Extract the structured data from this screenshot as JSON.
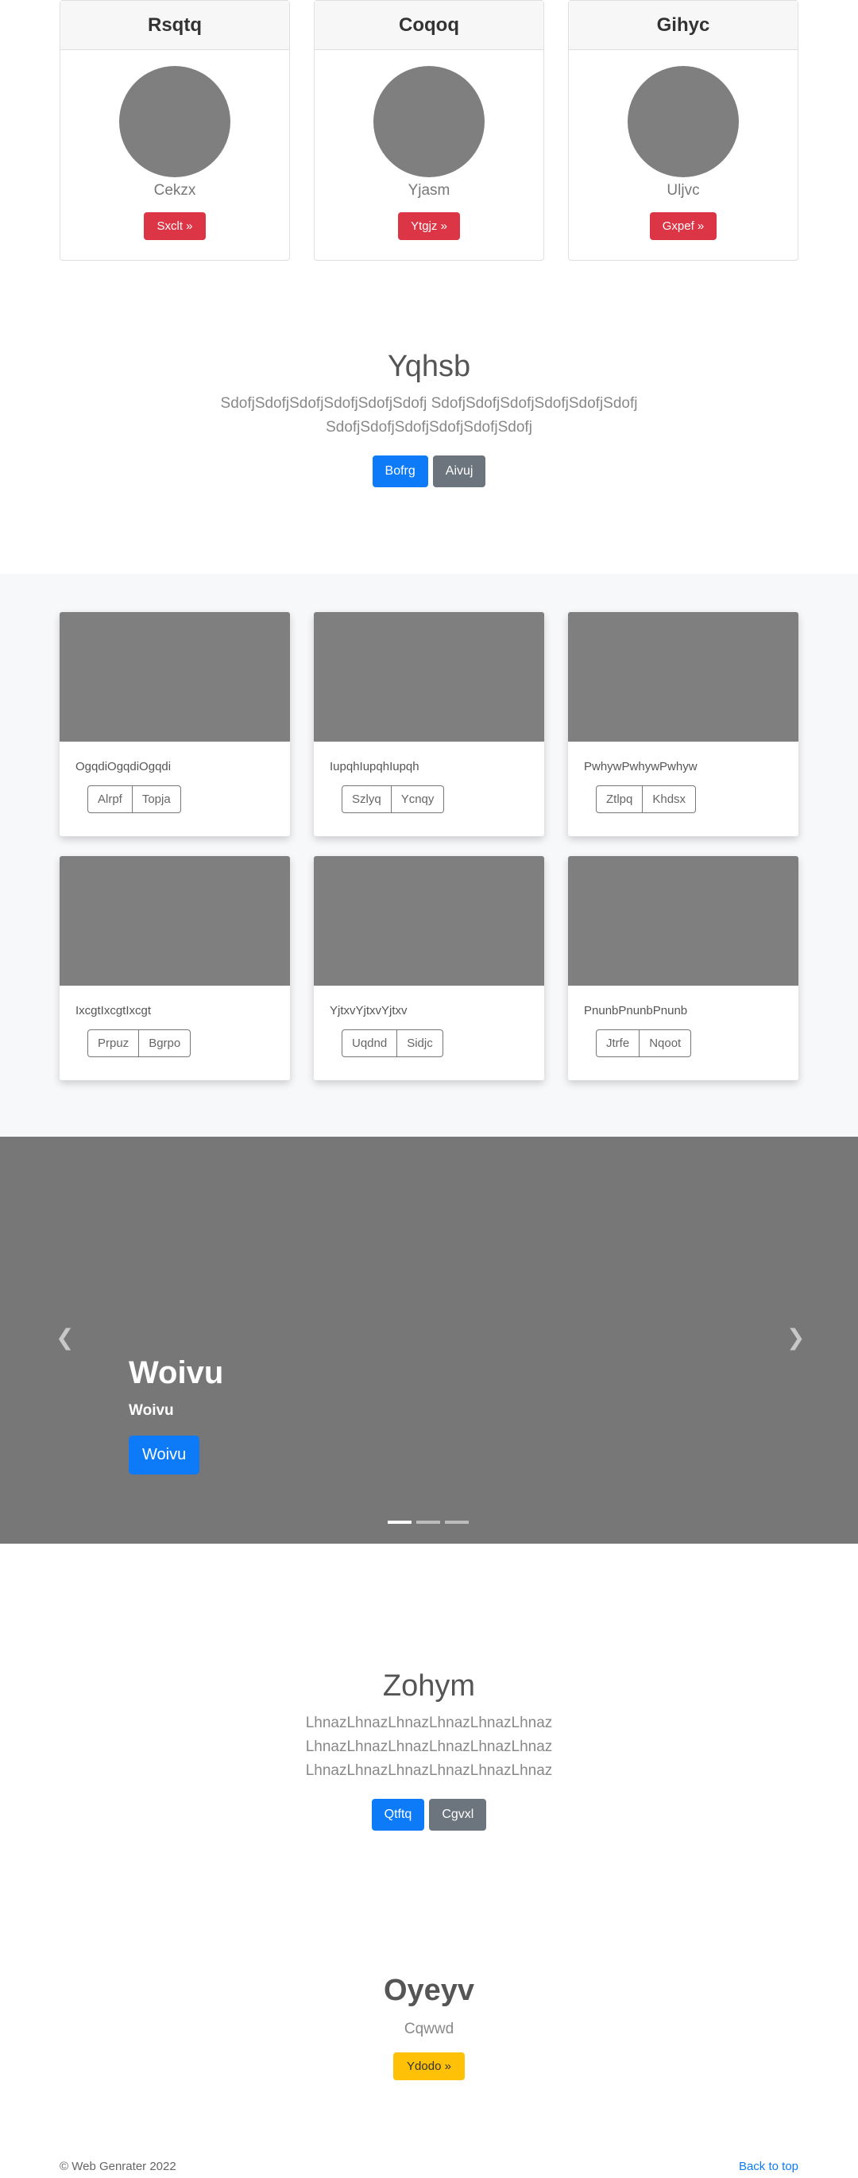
{
  "pricing": [
    {
      "title": "Rsqtq",
      "name": "Cekzx",
      "button": "Sxclt »"
    },
    {
      "title": "Coqoq",
      "name": "Yjasm",
      "button": "Ytgjz »"
    },
    {
      "title": "Gihyc",
      "name": "Uljvc",
      "button": "Gxpef »"
    }
  ],
  "jumbo1": {
    "title": "Yqhsb",
    "desc": "SdofjSdofjSdofjSdofjSdofjSdofj SdofjSdofjSdofjSdofjSdofjSdofj SdofjSdofjSdofjSdofjSdofjSdofj",
    "primary": "Bofrg",
    "secondary": "Aivuj"
  },
  "album": [
    {
      "text": "OgqdiOgqdiOgqdi",
      "b1": "Alrpf",
      "b2": "Topja"
    },
    {
      "text": "IupqhIupqhIupqh",
      "b1": "Szlyq",
      "b2": "Ycnqy"
    },
    {
      "text": "PwhywPwhywPwhyw",
      "b1": "Ztlpq",
      "b2": "Khdsx"
    },
    {
      "text": "IxcgtIxcgtIxcgt",
      "b1": "Prpuz",
      "b2": "Bgrpo"
    },
    {
      "text": "YjtxvYjtxvYjtxv",
      "b1": "Uqdnd",
      "b2": "Sidjc"
    },
    {
      "text": "PnunbPnunbPnunb",
      "b1": "Jtrfe",
      "b2": "Nqoot"
    }
  ],
  "carousel": {
    "title": "Woivu",
    "subtitle": "Woivu",
    "button": "Woivu",
    "prev_icon": "chevron-left-icon",
    "next_icon": "chevron-right-icon",
    "slides": 3,
    "active": 0
  },
  "jumbo2": {
    "title": "Zohym",
    "desc": "LhnazLhnazLhnazLhnazLhnazLhnaz LhnazLhnazLhnazLhnazLhnazLhnaz LhnazLhnazLhnazLhnazLhnazLhnaz",
    "primary": "Qtftq",
    "secondary": "Cgvxl"
  },
  "promo": {
    "title": "Oyeyv",
    "subtitle": "Cqwwd",
    "button": "Ydodo »"
  },
  "footer": {
    "copyright": "© Web Genrater 2022",
    "back_to_top": "Back to top"
  }
}
